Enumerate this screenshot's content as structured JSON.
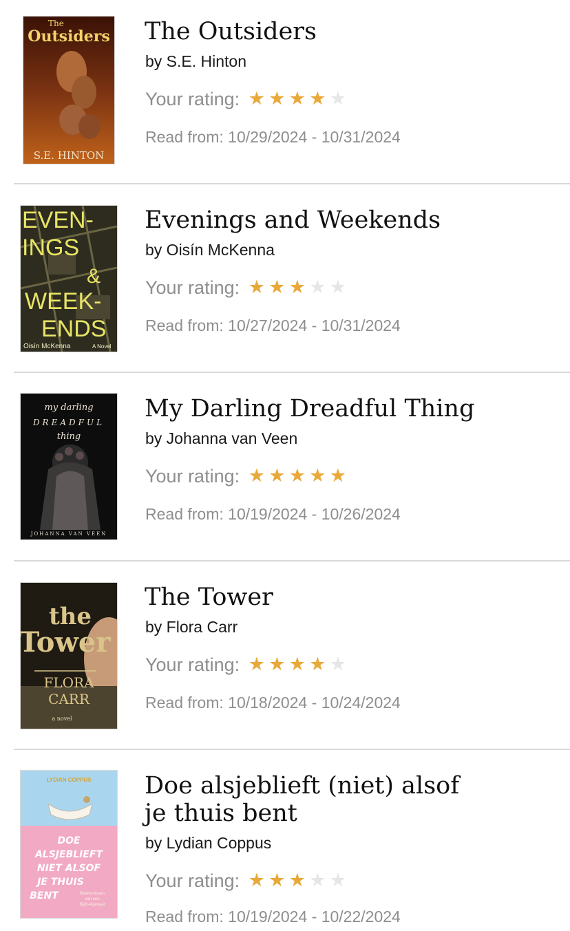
{
  "labels": {
    "your_rating": "Your rating:",
    "read_from": "Read from:"
  },
  "colors": {
    "star_filled": "#e9a93a",
    "star_empty": "#e6e6e6",
    "secondary_text": "#8e8e8e",
    "divider": "#d9d9d9"
  },
  "books": [
    {
      "title": "The Outsiders",
      "author": "by S.E. Hinton",
      "rating": 4,
      "read_dates": "10/29/2024 - 10/31/2024",
      "cover_text": [
        "The",
        "Outsiders",
        "S.E. HINTON"
      ]
    },
    {
      "title": "Evenings and Weekends",
      "author": "by Oisín McKenna",
      "rating": 3,
      "read_dates": "10/27/2024 - 10/31/2024",
      "cover_text": [
        "EVEN-",
        "INGS",
        "&",
        "WEEK-",
        "ENDS",
        "Oisín McKenna",
        "A Novel"
      ]
    },
    {
      "title": "My Darling Dreadful Thing",
      "author": "by Johanna van Veen",
      "rating": 5,
      "read_dates": "10/19/2024 - 10/26/2024",
      "cover_text": [
        "my darling",
        "DREADFUL",
        "thing",
        "JOHANNA VAN VEEN"
      ]
    },
    {
      "title": "The Tower",
      "author": "by Flora Carr",
      "rating": 4,
      "read_dates": "10/18/2024 - 10/24/2024",
      "cover_text": [
        "the",
        "Tower",
        "FLORA",
        "CARR",
        "a novel"
      ]
    },
    {
      "title": "Doe alsjeblieft (niet) alsof je thuis bent",
      "author": "by Lydian Coppus",
      "rating": 3,
      "read_dates": "10/19/2024 - 10/22/2024",
      "cover_text": [
        "LYDIAN COPPUS",
        "DOE",
        "ALSJEBLIEFT",
        "NIET ALSOF",
        "JE THUIS",
        "BENT",
        "Belevenissen",
        "van een",
        "B&B-eigenaar"
      ]
    }
  ]
}
